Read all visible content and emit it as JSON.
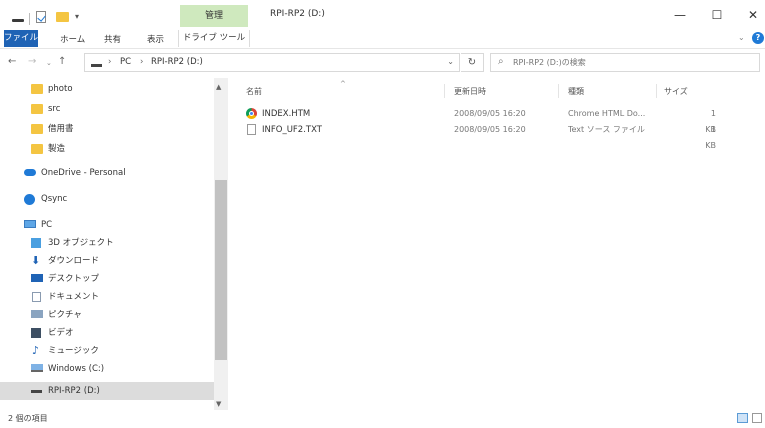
{
  "window": {
    "title": "RPI-RP2 (D:)",
    "controls": {
      "minimize": "—",
      "maximize": "☐",
      "close": "✕"
    }
  },
  "ribbon": {
    "context_tab": "管理",
    "tabs": {
      "file": "ファイル",
      "home": "ホーム",
      "share": "共有",
      "view": "表示",
      "drive_tools": "ドライブ ツール"
    },
    "expand": "⌄",
    "help": "?",
    "accent_color": "#1f63b5"
  },
  "nav": {
    "back": "←",
    "forward": "→",
    "recent": "⌄",
    "up": "↑",
    "address": {
      "sep1": "›",
      "pc": "PC",
      "sep2": "›",
      "drive": "RPI-RP2 (D:)",
      "dropdown": "⌄"
    },
    "refresh": "↻",
    "search_placeholder": "RPI-RP2 (D:)の検索"
  },
  "sidebar": {
    "items": [
      {
        "label": "photo",
        "icon": "folder-icon"
      },
      {
        "label": "src",
        "icon": "folder-icon"
      },
      {
        "label": "借用書",
        "icon": "folder-icon"
      },
      {
        "label": "製造",
        "icon": "folder-icon"
      },
      {
        "label": "OneDrive - Personal",
        "icon": "onedrive-cloud-icon"
      },
      {
        "label": "Qsync",
        "icon": "qsync-icon"
      },
      {
        "label": "PC",
        "icon": "pc-monitor-icon"
      },
      {
        "label": "3D オブジェクト",
        "icon": "3d-objects-icon"
      },
      {
        "label": "ダウンロード",
        "icon": "download-arrow-icon"
      },
      {
        "label": "デスクトップ",
        "icon": "desktop-icon"
      },
      {
        "label": "ドキュメント",
        "icon": "document-icon"
      },
      {
        "label": "ピクチャ",
        "icon": "pictures-icon"
      },
      {
        "label": "ビデオ",
        "icon": "video-icon"
      },
      {
        "label": "ミュージック",
        "icon": "music-note-icon"
      },
      {
        "label": "Windows (C:)",
        "icon": "windows-drive-icon"
      },
      {
        "label": "RPI-RP2 (D:)",
        "icon": "usb-drive-icon",
        "selected": true
      }
    ],
    "scroll_up": "▲",
    "scroll_down": "▼"
  },
  "filelist": {
    "columns": {
      "name": "名前",
      "date": "更新日時",
      "type": "種類",
      "size": "サイズ"
    },
    "sort_indicator": "^",
    "rows": [
      {
        "name": "INDEX.HTM",
        "date": "2008/09/05 16:20",
        "type": "Chrome HTML Do...",
        "size": "1 KB",
        "icon": "chrome-icon"
      },
      {
        "name": "INFO_UF2.TXT",
        "date": "2008/09/05 16:20",
        "type": "Text ソース ファイル",
        "size": "1 KB",
        "icon": "text-file-icon"
      }
    ]
  },
  "status": {
    "item_count": "2 個の項目"
  }
}
